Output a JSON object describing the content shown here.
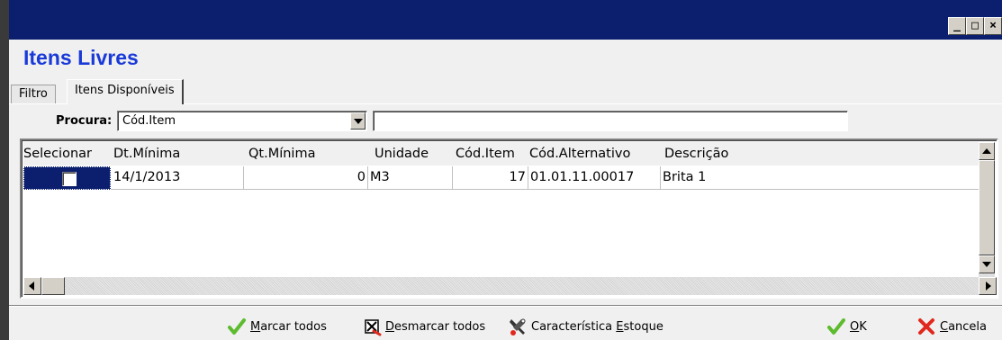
{
  "window": {
    "minimize_glyph": "_",
    "maximize_glyph": "□",
    "close_glyph": "×"
  },
  "page_title": "Itens Livres",
  "tabs": [
    {
      "label": "Filtro"
    },
    {
      "label": "Itens Disponíveis"
    }
  ],
  "filter": {
    "label": "Procura:",
    "combo_value": "Cód.Item",
    "search_value": ""
  },
  "grid": {
    "columns": [
      "Selecionar",
      "Dt.Mínima",
      "Qt.Mínima",
      "Unidade",
      "Cód.Item",
      "Cód.Alternativo",
      "Descrição"
    ],
    "rows": [
      {
        "selecionar": false,
        "dt_minima": "14/1/2013",
        "qt_minima": "0",
        "unidade": "M3",
        "cod_item": "17",
        "cod_alternativo": "01.01.11.00017",
        "descricao": "Brita 1"
      }
    ]
  },
  "buttons": {
    "marcar_todos": {
      "first": "M",
      "rest": "arcar todos"
    },
    "desmarcar_todos": {
      "first": "D",
      "rest": "esmarcar todos"
    },
    "caracteristica": {
      "pre": "Característica ",
      "first": "E",
      "rest": "stoque"
    },
    "ok": {
      "first": "O",
      "rest": "K"
    },
    "cancela": {
      "first": "C",
      "rest": "ancela"
    }
  },
  "colors": {
    "title_bar": "#0b1f6e",
    "page_title": "#1a3ad8",
    "selected_cell": "#0b1f6e",
    "check_green": "#5dbb2e",
    "cancel_red": "#e0281e"
  }
}
